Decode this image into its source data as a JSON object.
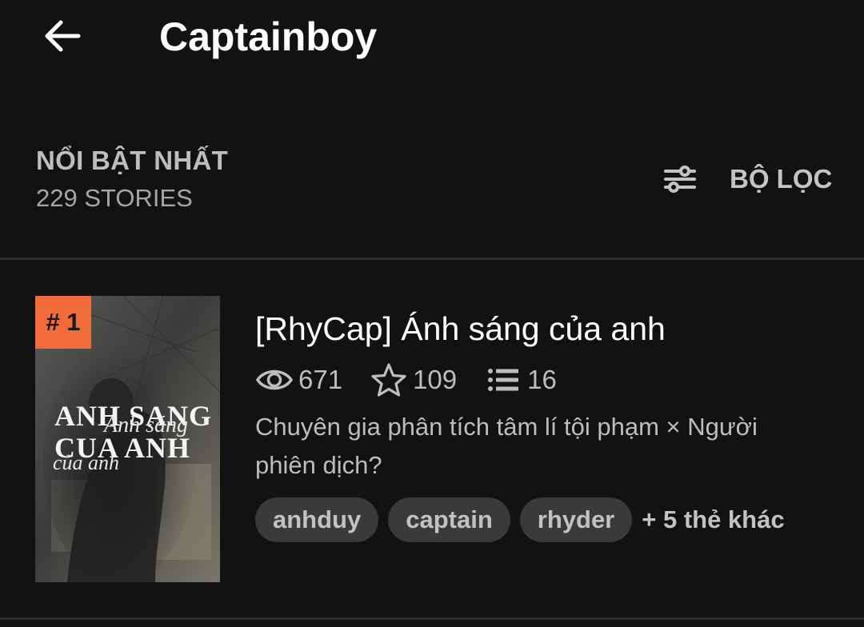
{
  "app_bar": {
    "back_icon": "arrow-left-icon",
    "title": "Captainboy"
  },
  "section": {
    "title": "NỔI BẬT NHẤT",
    "count": "229 STORIES",
    "filter_icon": "sliders-icon",
    "filter_label": "BỘ LỌC"
  },
  "stories": [
    {
      "rank": "# 1",
      "cover_title_main": "ANH SANG\nCUA ANH",
      "cover_title_script_1": "Ánh sáng",
      "cover_title_script_2": "của anh",
      "title": "[RhyCap] Ánh sáng của anh",
      "reads": "671",
      "votes": "109",
      "parts": "16",
      "description": "Chuyên gia phân tích tâm lí tội phạm × Người phiên dịch?",
      "tags": [
        "anhduy",
        "captain",
        "rhyder"
      ],
      "more_tags": "+ 5 thẻ khác"
    }
  ],
  "colors": {
    "background": "#121212",
    "rank_badge": "#f26b3a",
    "tag_bg": "#3a3a3a"
  }
}
